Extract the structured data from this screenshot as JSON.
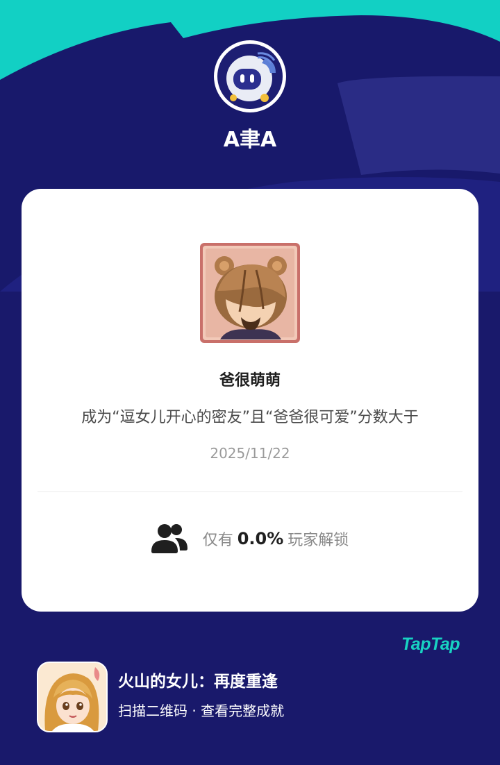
{
  "profile": {
    "username": "A聿A",
    "avatar_icon": "robot-avatar-icon"
  },
  "achievement": {
    "badge_icon": "bear-ears-character-badge",
    "title": "爸很萌萌",
    "description": "成为“逗女儿开心的密友”且“爸爸很可爱”分数大于",
    "date": "2025/11/22",
    "unlock_prefix": "仅有",
    "unlock_percent": "0.0%",
    "unlock_suffix": "玩家解锁",
    "players_icon": "players-icon"
  },
  "footer": {
    "brand": "TapTap",
    "game_name": "火山的女儿：再度重逢",
    "game_sub": "扫描二维码 · 查看完整成就",
    "game_icon": "game-cover-icon"
  },
  "colors": {
    "background": "#18196b",
    "accent_teal": "#18d2c2",
    "card": "#ffffff"
  }
}
